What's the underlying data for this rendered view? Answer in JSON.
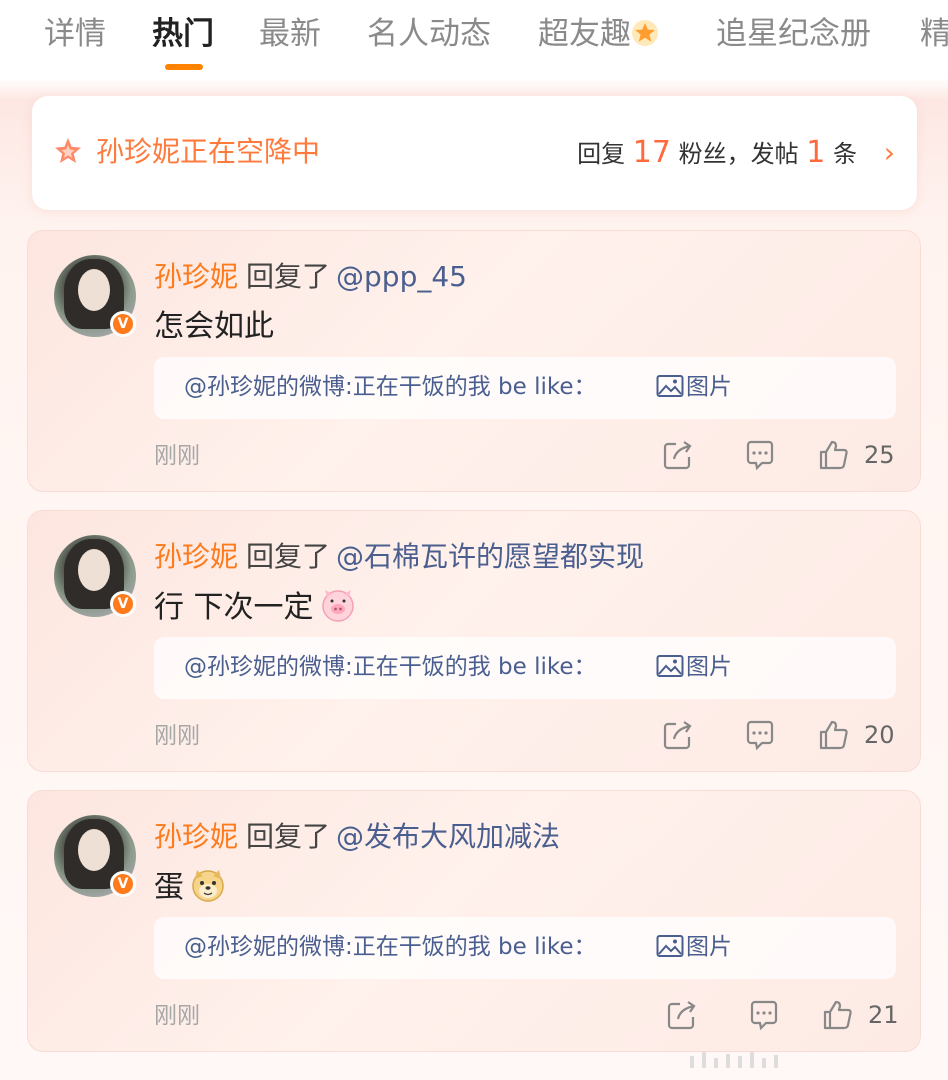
{
  "tabs": [
    "详情",
    "热门",
    "最新",
    "名人动态",
    "超友趣",
    "追星纪念册",
    "精"
  ],
  "active_tab": "热门",
  "banner": {
    "title": "孙珍妮正在空降中",
    "stat_prefix": "回复",
    "reply_count": "17",
    "stat_mid": "粉丝，发帖",
    "post_count": "1",
    "stat_suffix": "条"
  },
  "comments": [
    {
      "user": "孙珍妮",
      "reply_label": "回复了",
      "mention": "@ppp_45",
      "text": "怎会如此",
      "emoji": "",
      "quote": "@孙珍妮的微博:正在干饭的我 be like：",
      "quote_pic": "图片",
      "time": "刚刚",
      "likes": "25"
    },
    {
      "user": "孙珍妮",
      "reply_label": "回复了",
      "mention": "@石棉瓦许的愿望都实现",
      "text": "行 下次一定",
      "emoji": "pig-face",
      "quote": "@孙珍妮的微博:正在干饭的我 be like：",
      "quote_pic": "图片",
      "time": "刚刚",
      "likes": "20"
    },
    {
      "user": "孙珍妮",
      "reply_label": "回复了",
      "mention": "@发布大风加减法",
      "text": "蛋",
      "emoji": "doge-face",
      "quote": "@孙珍妮的微博:正在干饭的我 be like：",
      "quote_pic": "图片",
      "time": "刚刚",
      "likes": "21"
    }
  ],
  "colors": {
    "accent": "#ff7a1a",
    "mention": "#4a5f8f",
    "count": "#ff6a3d"
  }
}
